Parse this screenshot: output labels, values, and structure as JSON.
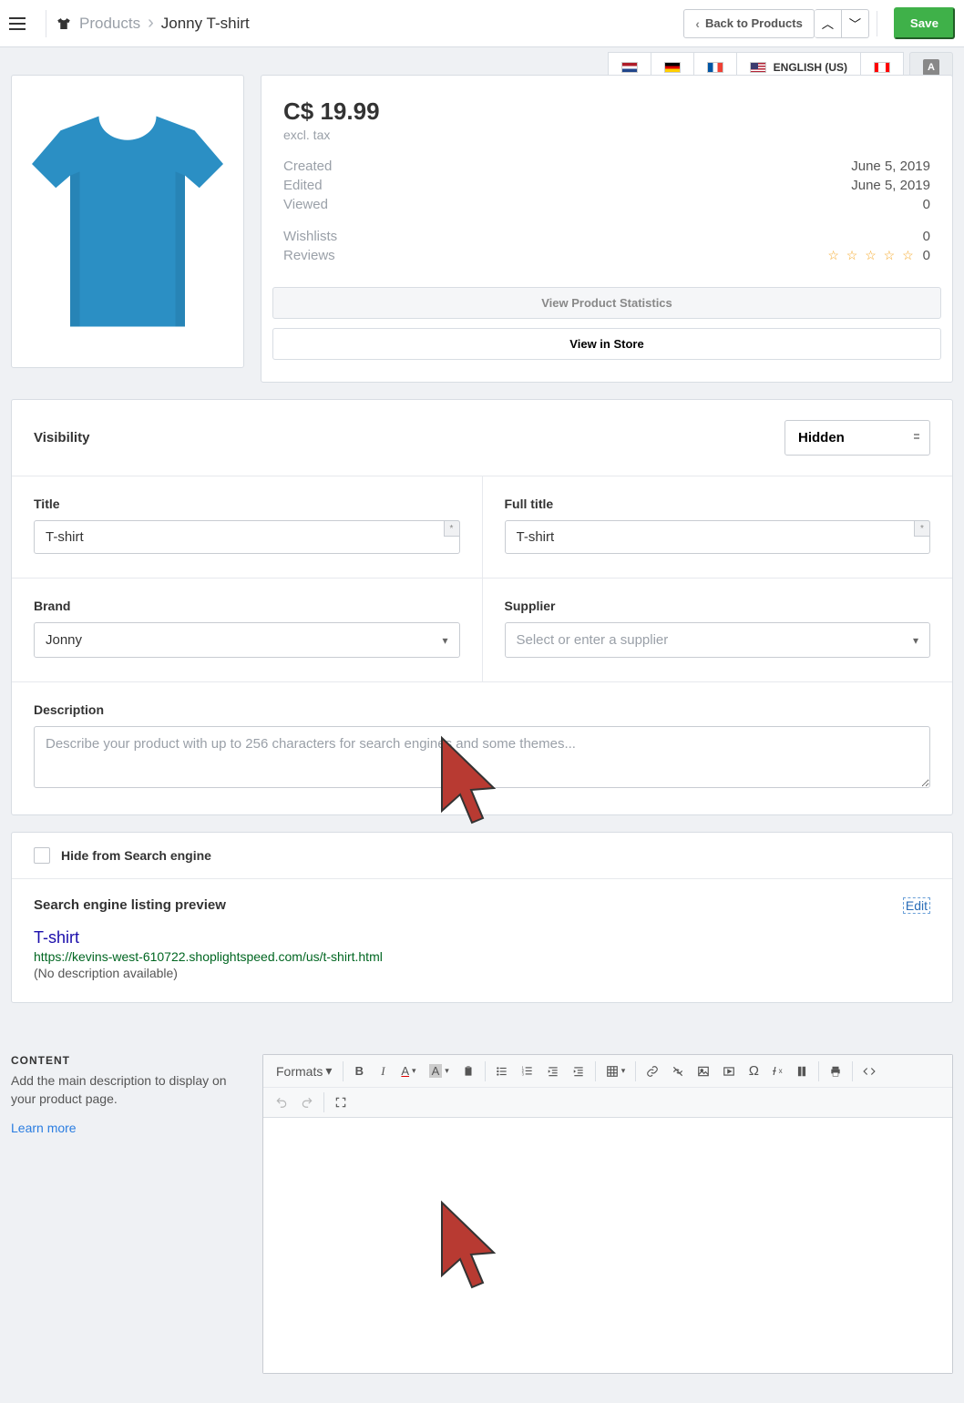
{
  "header": {
    "breadcrumb_root": "Products",
    "breadcrumb_current": "Jonny T-shirt",
    "back_label": "Back to Products",
    "save_label": "Save"
  },
  "languages": {
    "active_label": "ENGLISH (US)"
  },
  "product": {
    "price": "C$ 19.99",
    "tax_note": "excl. tax",
    "created_label": "Created",
    "created_value": "June 5, 2019",
    "edited_label": "Edited",
    "edited_value": "June 5, 2019",
    "viewed_label": "Viewed",
    "viewed_value": "0",
    "wishlists_label": "Wishlists",
    "wishlists_value": "0",
    "reviews_label": "Reviews",
    "reviews_stars": "☆ ☆ ☆ ☆ ☆",
    "reviews_value": "0",
    "stats_btn": "View Product Statistics",
    "store_btn": "View in Store"
  },
  "visibility": {
    "label": "Visibility",
    "value": "Hidden"
  },
  "fields": {
    "title_label": "Title",
    "title_value": "T-shirt",
    "fulltitle_label": "Full title",
    "fulltitle_value": "T-shirt",
    "brand_label": "Brand",
    "brand_value": "Jonny",
    "supplier_label": "Supplier",
    "supplier_placeholder": "Select or enter a supplier",
    "description_label": "Description",
    "description_placeholder": "Describe your product with up to 256 characters for search engines and some themes..."
  },
  "seo": {
    "hide_label": "Hide from Search engine",
    "preview_label": "Search engine listing preview",
    "edit_label": "Edit",
    "link_title": "T-shirt",
    "url": "https://kevins-west-610722.shoplightspeed.com/us/t-shirt.html",
    "no_desc": "(No description available)"
  },
  "content": {
    "heading": "CONTENT",
    "help": "Add the main description to display on your product page.",
    "learn": "Learn more",
    "formats": "Formats"
  }
}
